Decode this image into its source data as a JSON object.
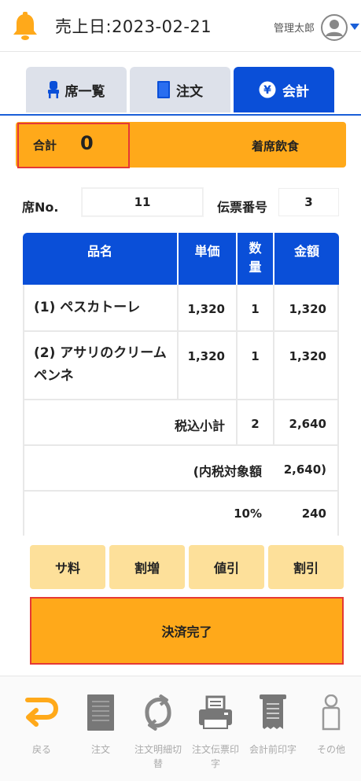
{
  "header": {
    "title": "売上日:2023-02-21",
    "user_name": "管理太郎",
    "colors": {
      "bell": "#ffa91a",
      "accent": "#1a5fd8"
    }
  },
  "tabs": [
    {
      "label": "席一覧",
      "icon": "chair-icon",
      "active": false
    },
    {
      "label": "注文",
      "icon": "notebook-icon",
      "active": false
    },
    {
      "label": "会計",
      "icon": "yen-icon",
      "active": true
    }
  ],
  "summary": {
    "total_label": "合計",
    "total_value": "0",
    "dine_type": "着席飲食"
  },
  "seat": {
    "seat_label": "席No.",
    "seat_value": "11",
    "slip_label": "伝票番号",
    "slip_value": "3"
  },
  "order_table": {
    "headers": {
      "name": "品名",
      "unit_price": "単価",
      "qty": "数量",
      "amount": "金額"
    },
    "items": [
      {
        "name": "(1) ペスカトーレ",
        "unit_price": "1,320",
        "qty": "1",
        "amount": "1,320"
      },
      {
        "name": "(2) アサリのクリームペンネ",
        "unit_price": "1,320",
        "qty": "1",
        "amount": "1,320"
      }
    ],
    "subtotal": {
      "label": "税込小計",
      "qty": "2",
      "amount": "2,640"
    },
    "taxable": {
      "label": "(内税対象額",
      "amount": "2,640)"
    },
    "tax": {
      "label": "10%",
      "amount": "240"
    }
  },
  "actions": {
    "service_charge": "サ料",
    "surcharge": "割増",
    "price_discount": "値引",
    "percent_discount": "割引",
    "complete": "決済完了"
  },
  "footer": [
    {
      "label": "戻る",
      "icon": "return-arrow-icon"
    },
    {
      "label": "注文",
      "icon": "document-icon"
    },
    {
      "label": "注文明細切替",
      "icon": "refresh-icon"
    },
    {
      "label": "注文伝票印字",
      "icon": "printer-icon"
    },
    {
      "label": "会計前印字",
      "icon": "receipt-icon"
    },
    {
      "label": "その他",
      "icon": "person-icon"
    }
  ]
}
